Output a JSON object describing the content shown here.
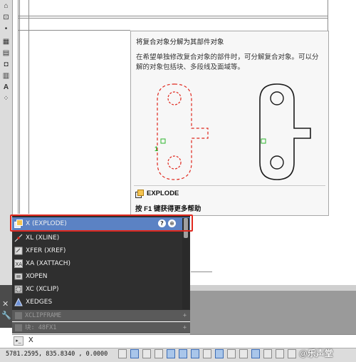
{
  "tooltip": {
    "title": "将复合对象分解为其部件对象",
    "description": "在希望单独修改复合对象的部件时，可分解复合对象。可以分解的对象包括块、多段线及面域等。",
    "annotation_number": "1",
    "command": "EXPLODE",
    "help": "按 F1 键获得更多帮助"
  },
  "autocomplete": {
    "items": [
      {
        "label": "X (EXPLODE)",
        "icon": "explode-icon",
        "selected": true
      },
      {
        "label": "XL (XLINE)",
        "icon": "xline-icon"
      },
      {
        "label": "XFER (XREF)",
        "icon": "xref-icon"
      },
      {
        "label": "XA (XATTACH)",
        "icon": "xattach-icon"
      },
      {
        "label": "XOPEN",
        "icon": "xopen-icon"
      },
      {
        "label": "XC (XCLIP)",
        "icon": "xclip-icon"
      },
      {
        "label": "XEDGES",
        "icon": "xedges-icon"
      }
    ],
    "history": [
      "XCLIPFRAME",
      "块: 48FX1"
    ]
  },
  "command_line": {
    "prompt_icon": "command-prompt-icon",
    "text": "X"
  },
  "status_bar": {
    "coordinates": "5781.2595, 835.8340 , 0.0000"
  },
  "watermark": "@乐声堂",
  "colors": {
    "selection": "#5b82c4",
    "highlight_border": "#e0281e",
    "dashed_red": "#e0281e",
    "grip_green": "#2db52d"
  }
}
